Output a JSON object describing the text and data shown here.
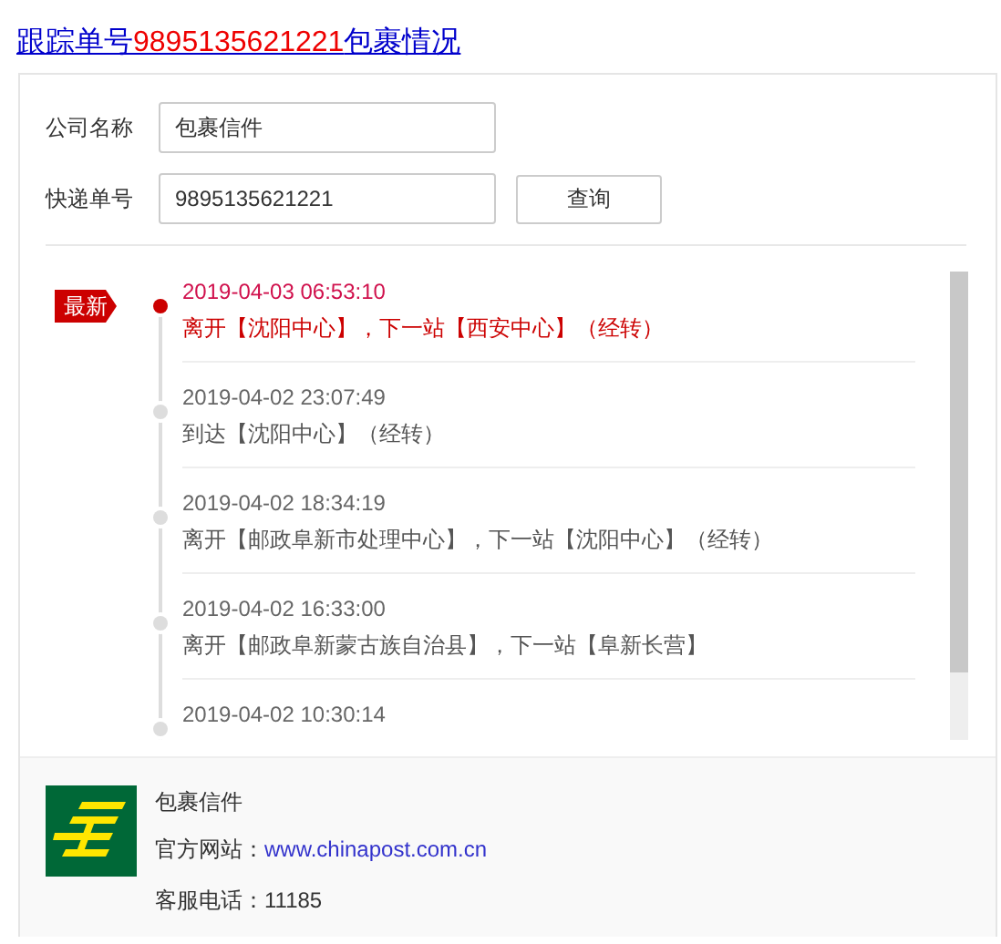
{
  "title": {
    "prefix": "跟踪单号",
    "number": "9895135621221",
    "suffix": "包裹情况"
  },
  "form": {
    "fields": [
      {
        "label": "公司名称",
        "value": "包裹信件"
      },
      {
        "label": "快递单号",
        "value": "9895135621221"
      }
    ],
    "button": "查询"
  },
  "events": [
    {
      "time": "2019-04-03 06:53:10",
      "description": "离开【沈阳中心】，下一站【西安中心】（经转）",
      "latest": true,
      "badge": "最新"
    },
    {
      "time": "2019-04-02 23:07:49",
      "description": "到达【沈阳中心】（经转）",
      "latest": false
    },
    {
      "time": "2019-04-02 18:34:19",
      "description": "离开【邮政阜新市处理中心】，下一站【沈阳中心】（经转）",
      "latest": false
    },
    {
      "time": "2019-04-02 16:33:00",
      "description": "离开【邮政阜新蒙古族自治县】，下一站【阜新长营】",
      "latest": false
    },
    {
      "time": "2019-04-02 10:30:14",
      "latest": false
    }
  ],
  "company": {
    "name": "包裹信件",
    "website_label": "官方网站：",
    "website": "www.chinapost.com.cn",
    "phone_label": "客服电话：",
    "phone": "11185"
  }
}
